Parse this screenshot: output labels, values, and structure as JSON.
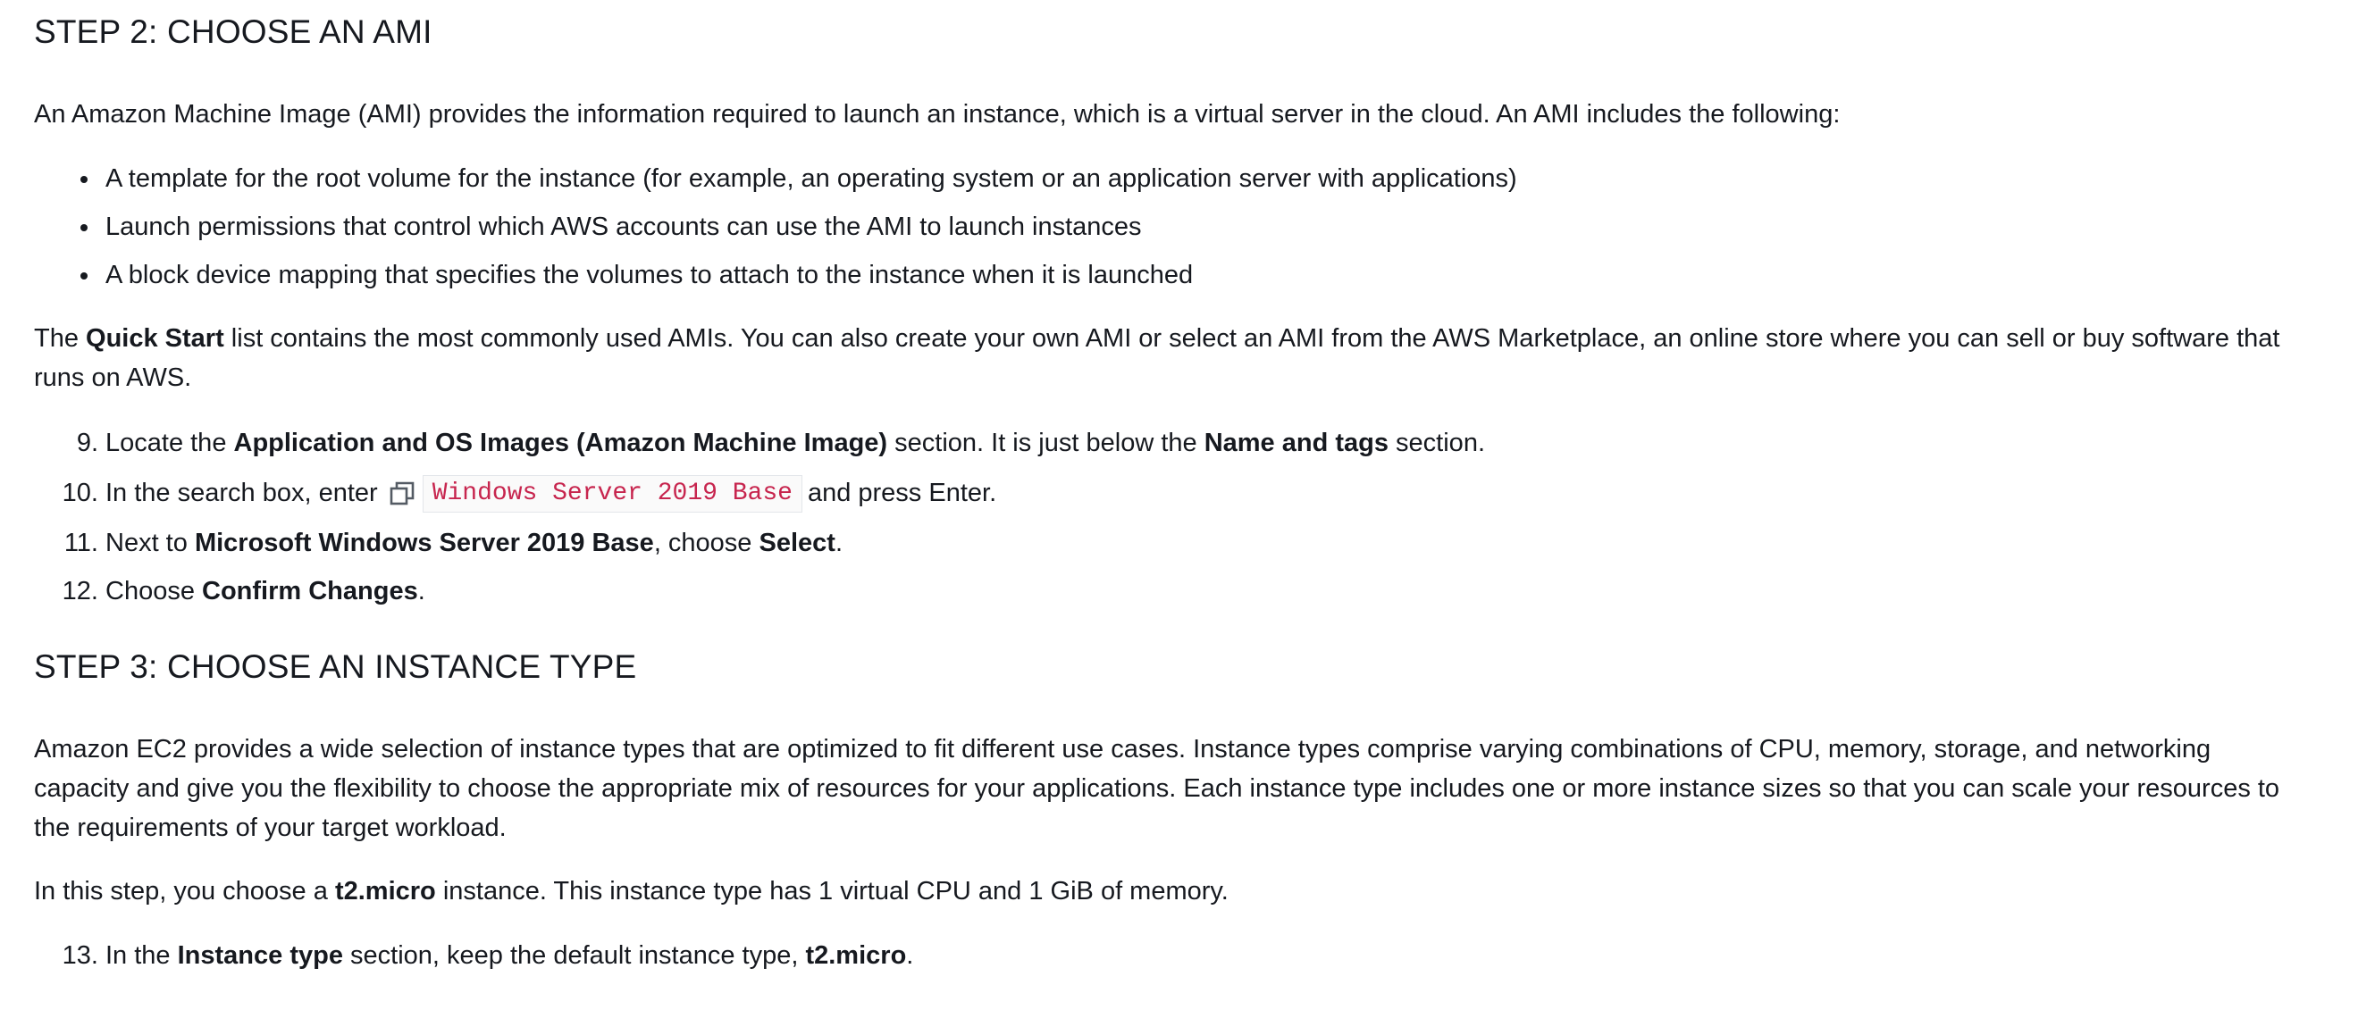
{
  "step2": {
    "heading": "STEP 2: CHOOSE AN AMI",
    "intro": "An Amazon Machine Image (AMI) provides the information required to launch an instance, which is a virtual server in the cloud. An AMI includes the following:",
    "bullets": [
      "A template for the root volume for the instance (for example, an operating system or an application server with applications)",
      "Launch permissions that control which AWS accounts can use the AMI to launch instances",
      "A block device mapping that specifies the volumes to attach to the instance when it is launched"
    ],
    "quickstart": {
      "prefix": "The ",
      "bold": "Quick Start",
      "suffix": " list contains the most commonly used AMIs. You can also create your own AMI or select an AMI from the AWS Marketplace, an online store where you can sell or buy software that runs on AWS."
    },
    "steps": [
      {
        "num": "9.",
        "t1": "Locate the ",
        "b1": "Application and OS Images (Amazon Machine Image)",
        "t2": " section. It is just below the ",
        "b2": "Name and tags",
        "t3": " section."
      },
      {
        "num": "10.",
        "t1": "In the search box, enter",
        "code": "Windows Server 2019 Base",
        "t2": "and press Enter."
      },
      {
        "num": "11.",
        "t1": "Next to ",
        "b1": "Microsoft Windows Server 2019 Base",
        "t2": ", choose ",
        "b2": "Select",
        "t3": "."
      },
      {
        "num": "12.",
        "t1": "Choose ",
        "b1": "Confirm Changes",
        "t2": "."
      }
    ]
  },
  "step3": {
    "heading": "STEP 3: CHOOSE AN INSTANCE TYPE",
    "intro": "Amazon EC2 provides a wide selection of instance types that are optimized to fit different use cases. Instance types comprise varying combinations of CPU, memory, storage, and networking capacity and give you the flexibility to choose the appropriate mix of resources for your applications. Each instance type includes one or more instance sizes so that you can scale your resources to the requirements of your target workload.",
    "choose": {
      "prefix": "In this step, you choose a ",
      "bold": "t2.micro",
      "suffix": " instance. This instance type has 1 virtual CPU and 1 GiB of memory."
    },
    "steps": [
      {
        "num": "13.",
        "t1": "In the ",
        "b1": "Instance type",
        "t2": " section, keep the default instance type, ",
        "b2": "t2.micro",
        "t3": "."
      }
    ]
  },
  "icons": {
    "copy": "copy-icon"
  }
}
